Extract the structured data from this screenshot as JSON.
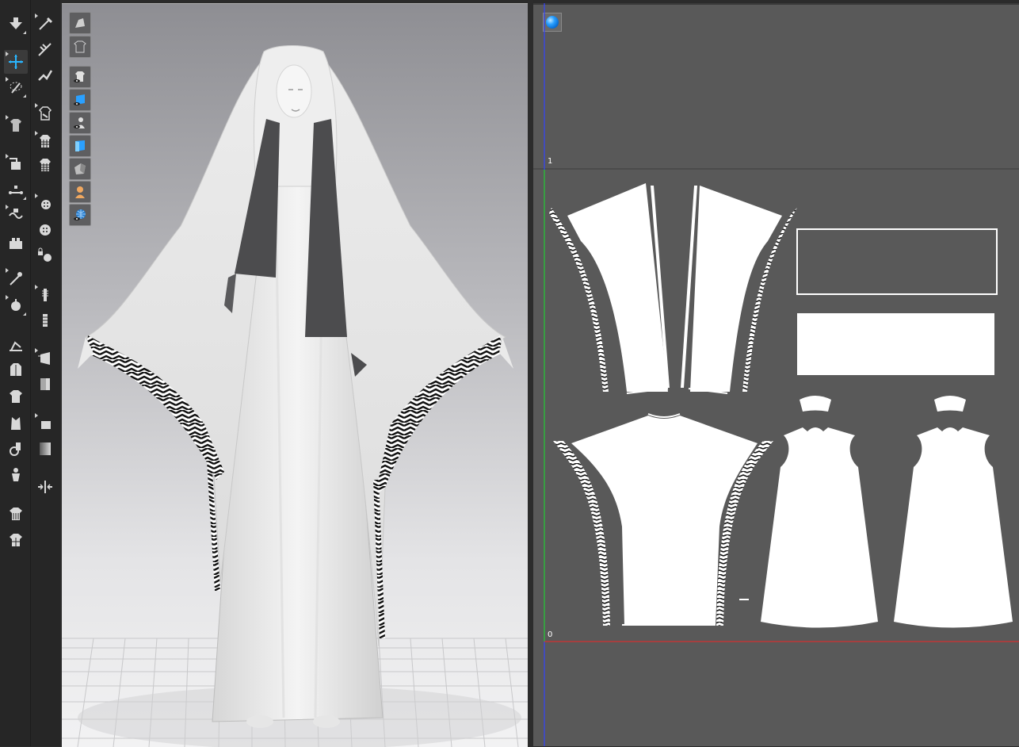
{
  "toolbar": {
    "left_column": [
      {
        "icon": "down-arrow-icon"
      },
      {
        "icon": "transform-move-icon",
        "active": true
      },
      {
        "icon": "lasso-select-icon"
      },
      {
        "icon": "garment-display-icon"
      },
      {
        "icon": "fold-arrange-icon"
      },
      {
        "icon": "measure-icon"
      },
      {
        "icon": "wrap-icon"
      },
      {
        "icon": "tack-icon"
      },
      {
        "icon": "pin-icon"
      },
      {
        "icon": "fitting-icon"
      },
      {
        "icon": "avatar-point-icon"
      },
      {
        "icon": "jacket-icon"
      },
      {
        "icon": "shirt-icon"
      },
      {
        "icon": "vest-icon"
      },
      {
        "icon": "hang-icon"
      },
      {
        "icon": "figure-icon"
      },
      {
        "icon": "shirt-stripe-icon"
      },
      {
        "icon": "shirt-grid-icon"
      }
    ],
    "right_column": [
      {
        "icon": "edit-point-icon"
      },
      {
        "icon": "needle-icon"
      },
      {
        "icon": "steam-icon"
      },
      {
        "icon": "shirt-sew-icon"
      },
      {
        "icon": "shirt-grid-small-icon"
      },
      {
        "icon": "shirt-check-icon"
      },
      {
        "icon": "button-icon"
      },
      {
        "icon": "button-hole-icon"
      },
      {
        "icon": "lock-button-icon"
      },
      {
        "icon": "zipper-icon"
      },
      {
        "icon": "zipper-pull-icon"
      },
      {
        "icon": "texture-icon"
      },
      {
        "icon": "texture-fill-icon"
      },
      {
        "icon": "gradient-icon"
      },
      {
        "icon": "gradient-fill-icon"
      },
      {
        "icon": "merge-icon"
      }
    ]
  },
  "viewport_3d": {
    "display_buttons": [
      {
        "icon": "avatar-display-icon"
      },
      {
        "icon": "garment-wireframe-icon"
      },
      {
        "icon": "garment-eye-icon"
      },
      {
        "icon": "texture-eye-icon"
      },
      {
        "icon": "avatar-eye-icon"
      },
      {
        "icon": "fabric-display-icon"
      },
      {
        "icon": "shading-icon"
      },
      {
        "icon": "skin-display-icon"
      },
      {
        "icon": "environment-eye-icon"
      }
    ]
  },
  "pattern_2d": {
    "axis_label_top": "1",
    "axis_label_bottom": "0"
  }
}
